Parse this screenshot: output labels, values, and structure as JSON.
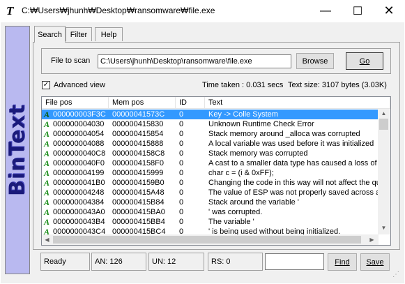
{
  "window": {
    "title": "C:₩Users₩jhunh₩Desktop₩ransomware₩file.exe"
  },
  "side_banner": {
    "text": "BinText"
  },
  "tabs": [
    {
      "label": "Search"
    },
    {
      "label": "Filter"
    },
    {
      "label": "Help"
    }
  ],
  "scan": {
    "label": "File to scan",
    "path": "C:\\Users\\jhunh\\Desktop\\ransomware\\file.exe",
    "browse_label": "Browse",
    "go_label": "Go"
  },
  "options": {
    "advanced_view_label": "Advanced view",
    "advanced_view_checked": true,
    "time_taken": "Time taken : 0.031 secs",
    "text_size": "Text size: 3107 bytes (3.03K)"
  },
  "table": {
    "columns": [
      "File pos",
      "Mem pos",
      "ID",
      "Text"
    ],
    "rows": [
      {
        "file_pos": "000000003F3C",
        "mem_pos": "00000041573C",
        "id": "0",
        "text": "Key -> Colle System",
        "selected": true
      },
      {
        "file_pos": "000000004030",
        "mem_pos": "000000415830",
        "id": "0",
        "text": "Unknown Runtime Check Error"
      },
      {
        "file_pos": "000000004054",
        "mem_pos": "000000415854",
        "id": "0",
        "text": "Stack memory around _alloca was corrupted"
      },
      {
        "file_pos": "000000004088",
        "mem_pos": "000000415888",
        "id": "0",
        "text": "A local variable was used before it was initialized"
      },
      {
        "file_pos": "0000000040C8",
        "mem_pos": "0000004158C8",
        "id": "0",
        "text": "Stack memory was corrupted"
      },
      {
        "file_pos": "0000000040F0",
        "mem_pos": "0000004158F0",
        "id": "0",
        "text": "A cast to a smaller data type has caused a loss of data."
      },
      {
        "file_pos": "000000004199",
        "mem_pos": "000000415999",
        "id": "0",
        "text": "char c = (i & 0xFF);"
      },
      {
        "file_pos": "0000000041B0",
        "mem_pos": "0000004159B0",
        "id": "0",
        "text": "Changing the code in this way will not affect the quality"
      },
      {
        "file_pos": "000000004248",
        "mem_pos": "000000415A48",
        "id": "0",
        "text": "The value of ESP was not properly saved across a function"
      },
      {
        "file_pos": "000000004384",
        "mem_pos": "000000415B84",
        "id": "0",
        "text": "Stack around the variable '"
      },
      {
        "file_pos": "0000000043A0",
        "mem_pos": "000000415BA0",
        "id": "0",
        "text": "' was corrupted."
      },
      {
        "file_pos": "0000000043B4",
        "mem_pos": "000000415BB4",
        "id": "0",
        "text": "The variable '"
      },
      {
        "file_pos": "0000000043C4",
        "mem_pos": "000000415BC4",
        "id": "0",
        "text": "' is being used without being initialized."
      }
    ]
  },
  "status": {
    "ready": "Ready",
    "an": "AN: 126",
    "un": "UN: 12",
    "rs": "RS: 0",
    "search_value": "",
    "find_label": "Find",
    "save_label": "Save"
  },
  "icons": {
    "app": "bintext-app-icon",
    "row": "ansi-a-icon"
  },
  "colors": {
    "selection": "#3399ff",
    "banner_bg": "#b9b9f0",
    "banner_text": "#1a1a7a",
    "ansi_icon": "#118811"
  }
}
